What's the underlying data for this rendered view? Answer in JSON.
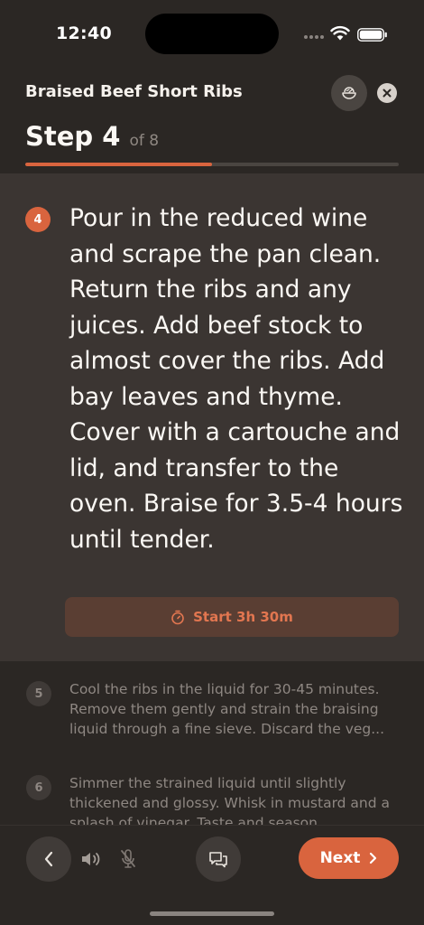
{
  "status_bar": {
    "time": "12:40"
  },
  "header": {
    "recipe_title": "Braised Beef Short Ribs",
    "step_label": "Step 4",
    "step_of": "of 8",
    "progress_fraction": 0.5
  },
  "current_step": {
    "number": "4",
    "text": "Pour in the reduced wine and scrape the pan clean. Return the ribs and any juices. Add beef stock to almost cover the ribs. Add bay leaves and thyme. Cover with a cartouche and lid, and transfer to the oven. Braise for 3.5-4 hours until tender.",
    "timer_label": "Start 3h 30m"
  },
  "upcoming_steps": [
    {
      "number": "5",
      "text": "Cool the ribs in the liquid for 30-45 minutes. Remove them gently and strain the braising liquid through a fine sieve. Discard the veg..."
    },
    {
      "number": "6",
      "text": "Simmer the strained liquid until slightly thickened and glossy. Whisk in mustard and a splash of vinegar. Taste and season."
    }
  ],
  "bottom_bar": {
    "next_label": "Next"
  },
  "colors": {
    "accent": "#d9643e",
    "background": "#2b2724",
    "card": "#3b3532"
  },
  "icons": [
    "bowl-icon",
    "close-icon",
    "timer-icon",
    "chevron-left-icon",
    "speaker-icon",
    "mic-off-icon",
    "chat-icon",
    "chevron-right-icon"
  ]
}
